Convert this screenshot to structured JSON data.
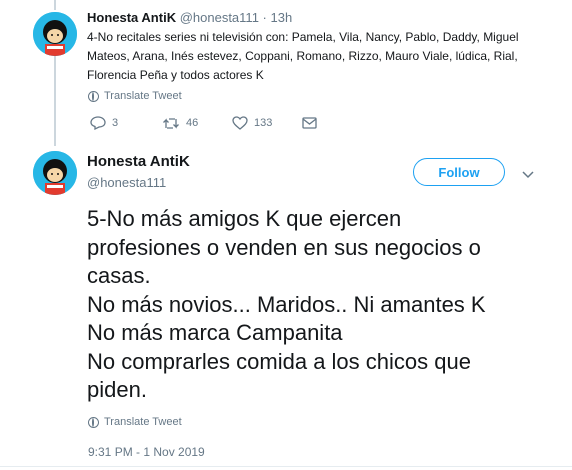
{
  "tweet1": {
    "name": "Honesta AntiK",
    "handle": "@honesta111",
    "separator": "·",
    "time": "13h",
    "text": "4-No recitales series ni televisión con: Pamela, Vila, Nancy, Pablo, Daddy, Miguel Mateos, Arana, Inés estevez, Coppani, Romano, Rizzo, Mauro Viale, lúdica, Rial, Florencia Peña y todos actores K",
    "translate_label": "Translate Tweet",
    "replies": "3",
    "retweets": "46",
    "likes": "133"
  },
  "tweet2": {
    "name": "Honesta AntiK",
    "handle": "@honesta111",
    "follow_label": "Follow",
    "lines": [
      "5-No más amigos K que ejercen",
      "profesiones o venden en sus negocios o",
      "casas.",
      "No más novios... Maridos.. Ni amantes K",
      "No más marca Campanita",
      "No comprarles comida a los chicos que",
      "piden."
    ],
    "translate_label": "Translate Tweet",
    "timestamp": "9:31 PM - 1 Nov 2019"
  },
  "colors": {
    "accent": "#1da1f2",
    "muted": "#657786",
    "avatar_bg": "#27b7e6"
  },
  "icons": [
    "avatar-mafalda",
    "reply-icon",
    "retweet-icon",
    "like-icon",
    "dm-icon",
    "globe-icon",
    "chevron-down-icon"
  ]
}
